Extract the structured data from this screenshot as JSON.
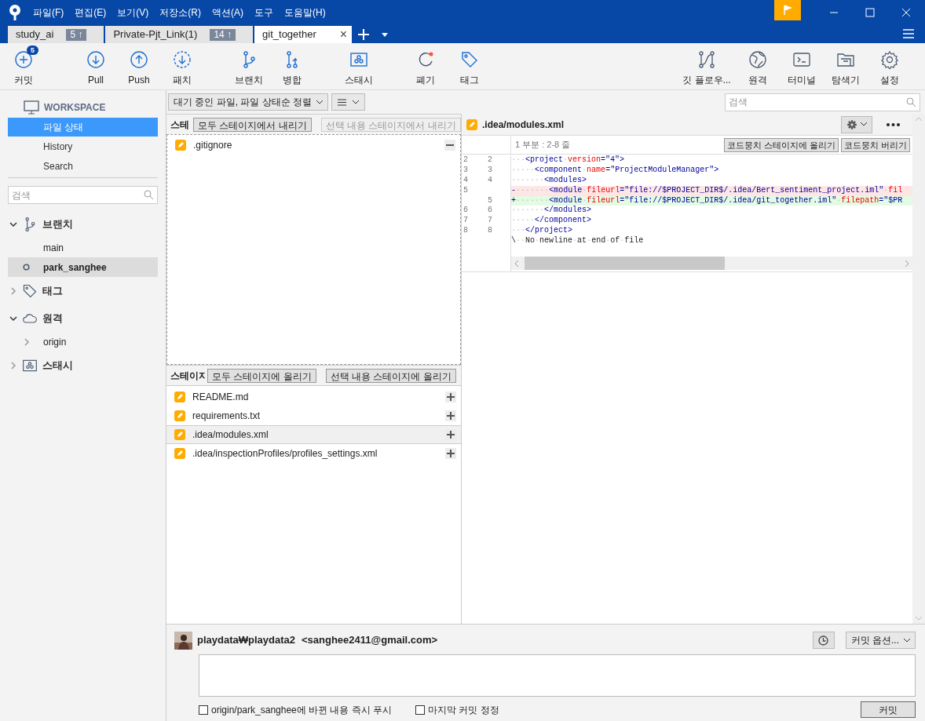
{
  "menu": [
    "파일(F)",
    "편집(E)",
    "보기(V)",
    "저장소(R)",
    "액션(A)",
    "도구",
    "도움말(H)"
  ],
  "tabs": [
    {
      "label": "study_ai",
      "badge": "5 ↑",
      "selected": false
    },
    {
      "label": "Private-Pjt_Link(1)",
      "badge": "14 ↑",
      "selected": false
    },
    {
      "label": "git_together",
      "selected": true,
      "close": "×"
    }
  ],
  "toolbar": [
    {
      "label": "커밋",
      "kind": "plus",
      "badge": "5"
    },
    {
      "label": "Pull",
      "kind": "down"
    },
    {
      "label": "Push",
      "kind": "up"
    },
    {
      "label": "패치",
      "kind": "fetch"
    },
    {
      "label": "브랜치",
      "kind": "branch"
    },
    {
      "label": "병합",
      "kind": "merge"
    },
    {
      "label": "스태시",
      "kind": "stash"
    },
    {
      "label": "폐기",
      "kind": "discard"
    },
    {
      "label": "태그",
      "kind": "tag"
    }
  ],
  "toolbar_right": [
    {
      "label": "깃 플로우...",
      "kind": "flow"
    },
    {
      "label": "원격",
      "kind": "globe"
    },
    {
      "label": "터미널",
      "kind": "terminal"
    },
    {
      "label": "탐색기",
      "kind": "folder"
    },
    {
      "label": "설정",
      "kind": "gear"
    }
  ],
  "sidebar": {
    "workspace": "WORKSPACE",
    "nav": [
      {
        "label": "파일 상태",
        "selected": true
      },
      {
        "label": "History",
        "selected": false
      },
      {
        "label": "Search",
        "selected": false
      }
    ],
    "search_placeholder": "검색",
    "sections": [
      {
        "label": "브랜치",
        "kind": "branch",
        "expanded": true,
        "children": [
          {
            "label": "main",
            "selected": false,
            "current": false
          },
          {
            "label": "park_sanghee",
            "selected": true,
            "current": true
          }
        ]
      },
      {
        "label": "태그",
        "kind": "tag",
        "expanded": false
      },
      {
        "label": "원격",
        "kind": "cloud",
        "expanded": true,
        "children": [
          {
            "label": "origin",
            "selected": false,
            "current": false,
            "expandable": true
          }
        ]
      },
      {
        "label": "스태시",
        "kind": "stash",
        "expanded": false
      }
    ]
  },
  "filter": {
    "sort": "대기 중인 파일, 파일 상태순 정렬",
    "search_placeholder": "검색"
  },
  "staged": {
    "header": "스테",
    "buttons": [
      {
        "label": "모두 스테이지에서 내리기",
        "disabled": false
      },
      {
        "label": "선택 내용 스테이지에서 내리기",
        "disabled": true
      }
    ],
    "files": [
      {
        "name": ".gitignore",
        "selected": false
      }
    ]
  },
  "unstaged": {
    "header": "스테이지",
    "buttons": [
      {
        "label": "모두 스테이지에 올리기",
        "disabled": false
      },
      {
        "label": "선택 내용 스테이지에 올리기",
        "disabled": false
      }
    ],
    "files": [
      {
        "name": "README.md",
        "selected": false
      },
      {
        "name": "requirements.txt",
        "selected": false
      },
      {
        "name": ".idea/modules.xml",
        "selected": true
      },
      {
        "name": ".idea/inspectionProfiles/profiles_settings.xml",
        "selected": false
      }
    ]
  },
  "diff": {
    "file": ".idea/modules.xml",
    "hunk": "1 부분 : 2-8 줄",
    "buttons": [
      "코드뭉치 스테이지에 올리기",
      "코드뭉치 버리기"
    ],
    "lines": [
      {
        "old": "2",
        "new": "2",
        "kind": "context",
        "text": "···<project·version=\"4\">"
      },
      {
        "old": "3",
        "new": "3",
        "kind": "context",
        "text": "·····<component·name=\"ProjectModuleManager\">"
      },
      {
        "old": "4",
        "new": "4",
        "kind": "context",
        "text": "·······<modules>"
      },
      {
        "old": "5",
        "kind": "removed",
        "text": "-·······<module·fileurl=\"file://$PROJECT_DIR$/.idea/Bert_sentiment_project.iml\"·fil"
      },
      {
        "new": "5",
        "kind": "added",
        "text": "+·······<module·fileurl=\"file://$PROJECT_DIR$/.idea/git_together.iml\"·filepath=\"$PR"
      },
      {
        "old": "6",
        "new": "6",
        "kind": "context",
        "text": "·······</modules>"
      },
      {
        "old": "7",
        "new": "7",
        "kind": "context",
        "text": "·····</component>"
      },
      {
        "old": "8",
        "new": "8",
        "kind": "context",
        "text": "···</project>"
      },
      {
        "kind": "note",
        "text": "\\··No·newline·at·end·of·file"
      }
    ]
  },
  "commit": {
    "author": "playdata₩playdata2",
    "email": "<sanghee2411@gmail.com>",
    "options": "커밋 옵션...",
    "checkboxes": [
      {
        "label": "origin/park_sanghee에 바뀐 내용 즉시 푸시",
        "checked": false
      },
      {
        "label": "마지막 커밋 정정",
        "checked": false
      }
    ],
    "button": "커밋"
  }
}
